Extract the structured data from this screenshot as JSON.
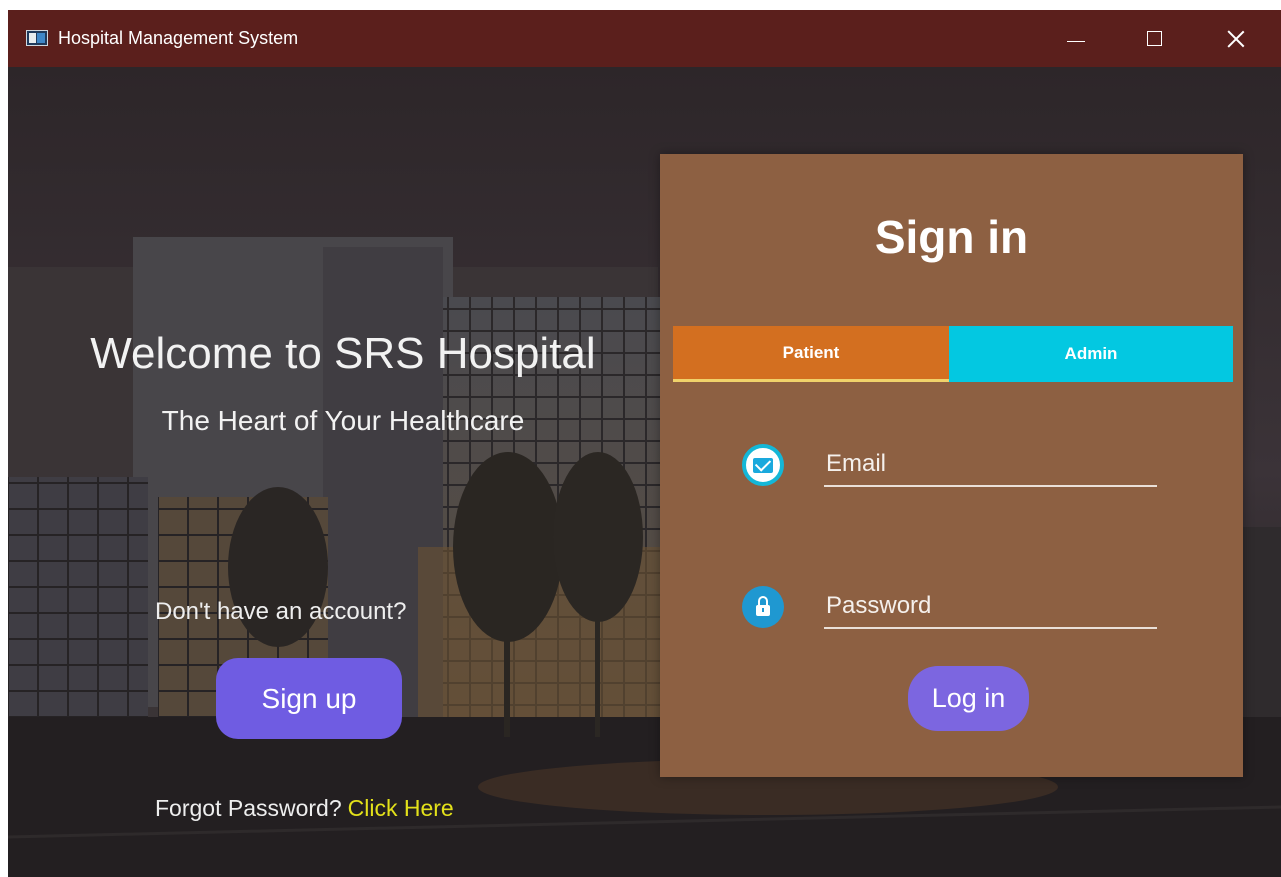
{
  "window": {
    "title": "Hospital Management System",
    "titlebar_color": "#5b1f1c",
    "controls": [
      "minimize-icon",
      "maximize-icon",
      "close-icon"
    ]
  },
  "welcome": {
    "heading": "Welcome to SRS Hospital",
    "tagline": "The Heart of Your Healthcare",
    "no_account_text": "Don't have an account?",
    "signup_label": "Sign up",
    "forgot_text": "Forgot Password?",
    "forgot_link": "Click Here",
    "signup_color": "#6f5ce2",
    "link_color": "#e3e11a"
  },
  "signin": {
    "title": "Sign in",
    "panel_color": "#8d6042",
    "tabs": [
      {
        "label": "Patient",
        "color": "#d36f20",
        "selected": true
      },
      {
        "label": "Admin",
        "color": "#03c8e1",
        "selected": false
      }
    ],
    "email": {
      "placeholder": "Email",
      "value": "",
      "icon": "envelope-icon"
    },
    "password": {
      "placeholder": "Password",
      "value": "",
      "icon": "lock-icon"
    },
    "login_label": "Log in",
    "login_color": "#7c66e0"
  }
}
